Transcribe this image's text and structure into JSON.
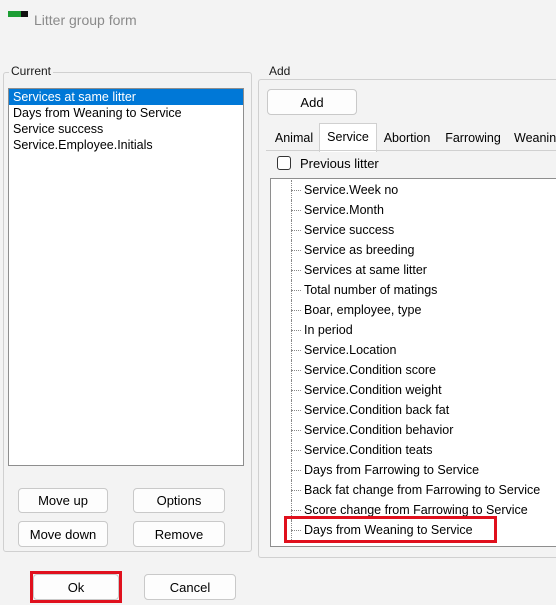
{
  "window": {
    "title": "Litter group form",
    "icon": "app-logo-icon"
  },
  "current": {
    "label": "Current",
    "items": [
      "Services at same litter",
      "Days from Weaning  to Service",
      "Service success",
      "Service.Employee.Initials"
    ],
    "selected_index": 0
  },
  "left_buttons": {
    "move_up": "Move up",
    "options": "Options",
    "move_down": "Move down",
    "remove": "Remove"
  },
  "add": {
    "label": "Add",
    "button": "Add",
    "tabs": [
      "Animal",
      "Service",
      "Abortion",
      "Farrowing",
      "Weanin"
    ],
    "active_tab": "Service",
    "previous_litter": {
      "label": "Previous litter",
      "checked": false
    },
    "tree_items": [
      "Service.Week no",
      "Service.Month",
      "Service success",
      "Service as breeding",
      "Services at same litter",
      "Total number of matings",
      "Boar, employee, type",
      "In period",
      "Service.Location",
      "Service.Condition score",
      "Service.Condition weight",
      "Service.Condition back fat",
      "Service.Condition behavior",
      "Service.Condition teats",
      "Days from Farrowing  to Service",
      "Back fat change from Farrowing to Service",
      "Score change from Farrowing to Service",
      "Days from Weaning  to Service"
    ],
    "highlighted_item": "Days from Weaning  to Service"
  },
  "footer": {
    "ok": "Ok",
    "cancel": "Cancel"
  },
  "colors": {
    "selection": "#0078d7",
    "highlight": "#e0101d",
    "icon_green": "#1d9e34"
  }
}
